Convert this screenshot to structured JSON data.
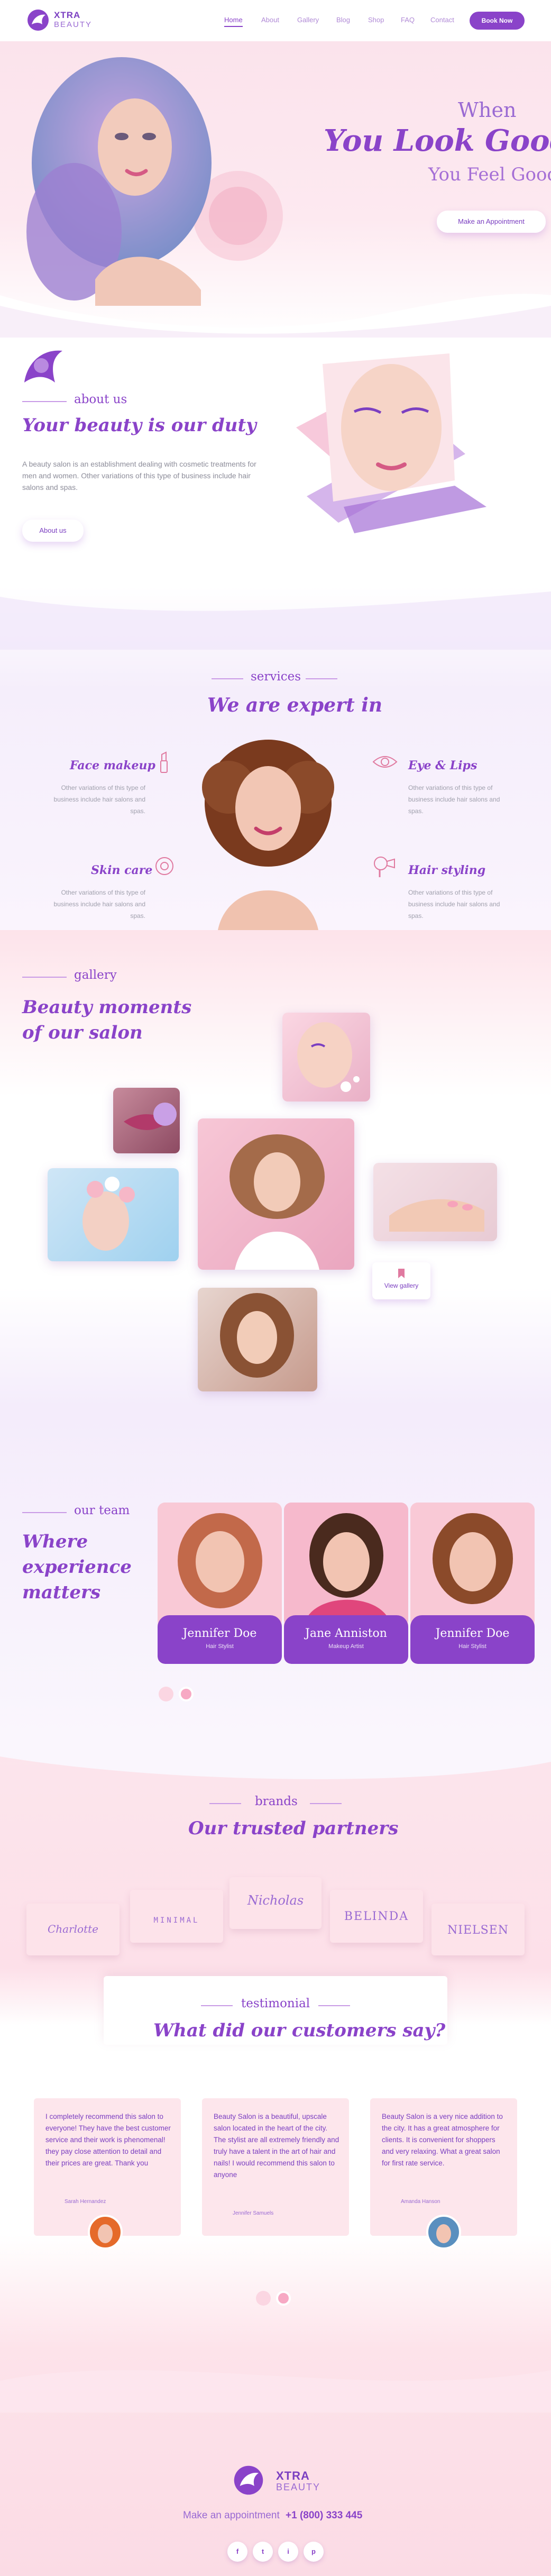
{
  "header": {
    "brand": "XTRA",
    "brand_sub": "BEAUTY",
    "nav": [
      "Home",
      "About",
      "Gallery",
      "Blog",
      "Shop",
      "FAQ",
      "Contact"
    ],
    "book": "Book Now"
  },
  "hero": {
    "line1": "When",
    "line2": "You Look Good",
    "line3": "You Feel Good",
    "cta": "Make an Appointment"
  },
  "about": {
    "kicker": "about us",
    "title": "Your beauty is our duty",
    "text": "A beauty salon is an establishment dealing with cosmetic treatments for men and women. Other variations of this type of business include hair salons and spas.",
    "button": "About us"
  },
  "services": {
    "kicker": "services",
    "title": "We are expert in",
    "items": [
      {
        "title": "Face makeup",
        "desc": "Other variations of this type of business include hair salons and spas."
      },
      {
        "title": "Eye & Lips",
        "desc": "Other variations of this type of business include hair salons and spas."
      },
      {
        "title": "Skin care",
        "desc": "Other variations of this type of business include hair salons and spas."
      },
      {
        "title": "Hair styling",
        "desc": "Other variations of this type of business include hair salons and spas."
      }
    ]
  },
  "gallery": {
    "kicker": "gallery",
    "title1": "Beauty moments",
    "title2": "of our salon",
    "button": "View gallery"
  },
  "team": {
    "kicker": "our team",
    "title1": "Where",
    "title2": "experience",
    "title3": "matters",
    "members": [
      {
        "name": "Jennifer Doe",
        "role": "Hair Stylist"
      },
      {
        "name": "Jane Anniston",
        "role": "Makeup Artist"
      },
      {
        "name": "Jennifer Doe",
        "role": "Hair Stylist"
      }
    ]
  },
  "brands": {
    "kicker": "brands",
    "title": "Our trusted partners",
    "logos": [
      "Charlotte",
      "MINIMAL",
      "Nicholas",
      "BELINDA",
      "NIELSEN"
    ]
  },
  "testimonial": {
    "kicker": "testimonial",
    "title": "What did our customers say?",
    "items": [
      {
        "text": "I completely recommend this salon to everyone! They have the best customer service and their work is phenomenal! they pay close attention to detail and their prices are great. Thank you",
        "author": "Sarah Hernandez"
      },
      {
        "text": "Beauty Salon is a beautiful, upscale salon located in the heart of the city. The stylist are all extremely friendly and truly have a talent in the art of hair and nails! I would recommend this salon to anyone",
        "author": "Jennifer Samuels"
      },
      {
        "text": "Beauty Salon is a very nice addition to the city. It has a great atmosphere for clients. It is convenient for shoppers and very relaxing. What a great salon for first rate service.",
        "author": "Amanda Hanson"
      }
    ]
  },
  "footer": {
    "brand": "XTRA",
    "brand_sub": "BEAUTY",
    "appointment": "Make an appointment",
    "phone": "+1 (800) 333 445",
    "social": [
      "f",
      "t",
      "i",
      "p"
    ]
  },
  "colors": {
    "accent": "#8a43c9",
    "pink": "#fde3ea"
  }
}
